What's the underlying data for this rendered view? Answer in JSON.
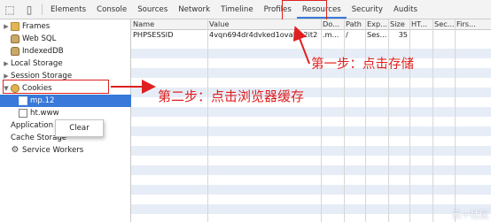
{
  "toolbar": {
    "tabs": [
      {
        "label": "Elements"
      },
      {
        "label": "Console"
      },
      {
        "label": "Sources"
      },
      {
        "label": "Network"
      },
      {
        "label": "Timeline"
      },
      {
        "label": "Profiles"
      },
      {
        "label": "Resources"
      },
      {
        "label": "Security"
      },
      {
        "label": "Audits"
      }
    ],
    "active_tab": "Resources"
  },
  "sidebar": {
    "items": [
      {
        "label": "Frames",
        "icon": "folder-icon"
      },
      {
        "label": "Web SQL",
        "icon": "database-icon"
      },
      {
        "label": "IndexedDB",
        "icon": "database-icon"
      },
      {
        "label": "Local Storage",
        "icon": "grid-icon"
      },
      {
        "label": "Session Storage",
        "icon": "grid-icon"
      },
      {
        "label": "Cookies",
        "icon": "cookie-icon"
      },
      {
        "label": "mp.12",
        "icon": "page-icon"
      },
      {
        "label": "ht.www",
        "icon": "page-icon"
      },
      {
        "label": "Application Cache",
        "icon": "grid-icon"
      },
      {
        "label": "Cache Storage",
        "icon": "grid-icon"
      },
      {
        "label": "Service Workers",
        "icon": "gear-icon"
      }
    ],
    "context_menu": {
      "clear_label": "Clear"
    }
  },
  "grid": {
    "columns": [
      "Name",
      "Value",
      "Do...",
      "Path",
      "Exp...",
      "Size",
      "HT...",
      "Sec...",
      "Firs..."
    ],
    "rows": [
      [
        "PHPSESSID",
        "4vqn694dr4dvked1ovai0s2it2",
        ".m...",
        "/",
        "Ses...",
        "35",
        "",
        "",
        ""
      ]
    ]
  },
  "annotations": {
    "step1": "第一步：点击存储",
    "step2": "第二步：点击浏览器缓存",
    "color": "#e02020"
  },
  "watermark": "云+社区"
}
